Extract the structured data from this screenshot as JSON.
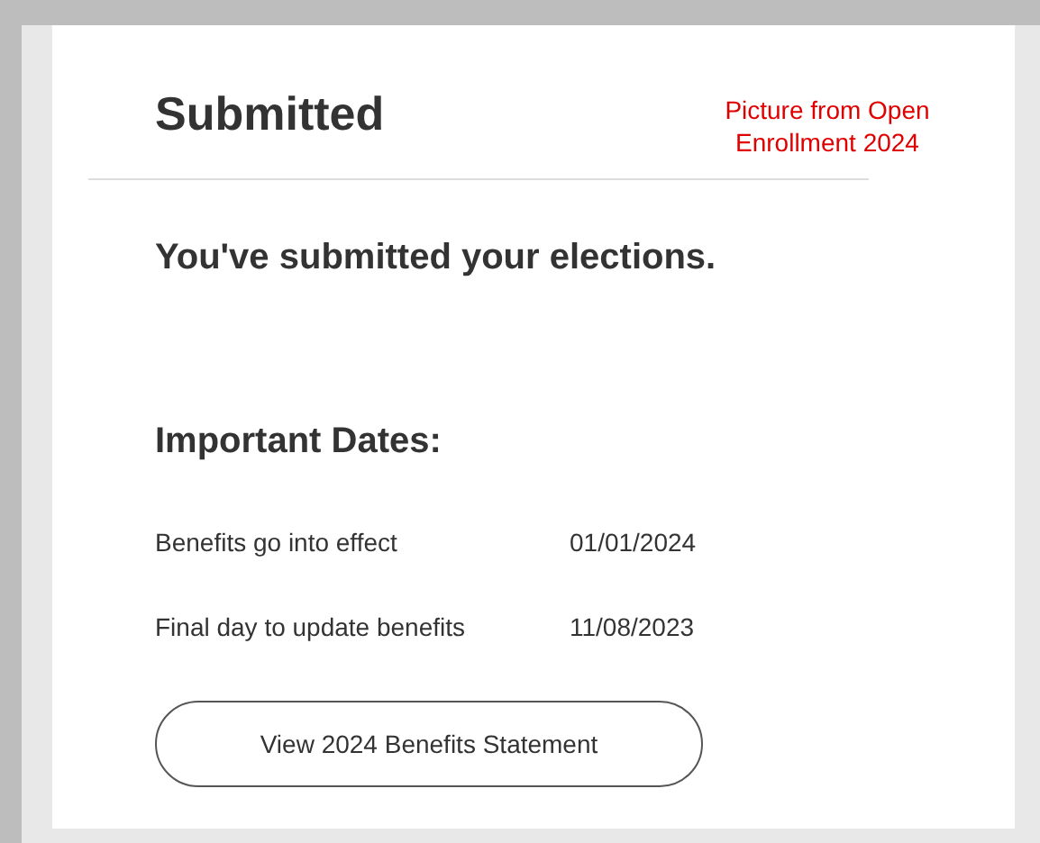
{
  "title": "Submitted",
  "note": [
    "Picture from Open",
    "Enrollment 2024"
  ],
  "message": "You've submitted your elections.",
  "dates_heading": "Important Dates:",
  "dates": [
    {
      "label": "Benefits go into effect",
      "value": "01/01/2024"
    },
    {
      "label": "Final day to update benefits",
      "value": "11/08/2023"
    }
  ],
  "button": "View 2024 Benefits Statement"
}
